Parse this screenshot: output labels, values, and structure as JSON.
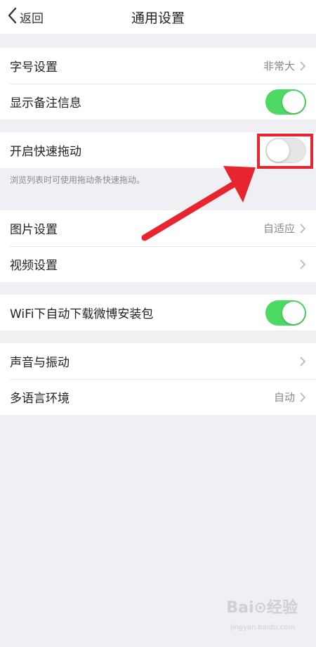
{
  "nav": {
    "back_label": "返回",
    "title": "通用设置"
  },
  "groups": [
    {
      "rows": [
        {
          "label": "字号设置",
          "value": "非常大"
        },
        {
          "label": "显示备注信息",
          "toggle": true
        }
      ]
    },
    {
      "rows": [
        {
          "label": "开启快速拖动",
          "toggle": false
        }
      ],
      "hint": "浏览列表时可使用拖动条快速拖动。"
    },
    {
      "rows": [
        {
          "label": "图片设置",
          "value": "自适应"
        },
        {
          "label": "视频设置"
        }
      ]
    },
    {
      "rows": [
        {
          "label": "WiFi下自动下载微博安装包",
          "toggle": true
        }
      ]
    },
    {
      "rows": [
        {
          "label": "声音与振动"
        },
        {
          "label": "多语言环境",
          "value": "自动"
        }
      ]
    }
  ],
  "watermark": {
    "text": "Bai⊙经验",
    "sub": "jingyan.baidu.com"
  },
  "colors": {
    "toggle_on": "#4cd964",
    "annotation_red": "#e8252f",
    "background": "#efeff4"
  }
}
